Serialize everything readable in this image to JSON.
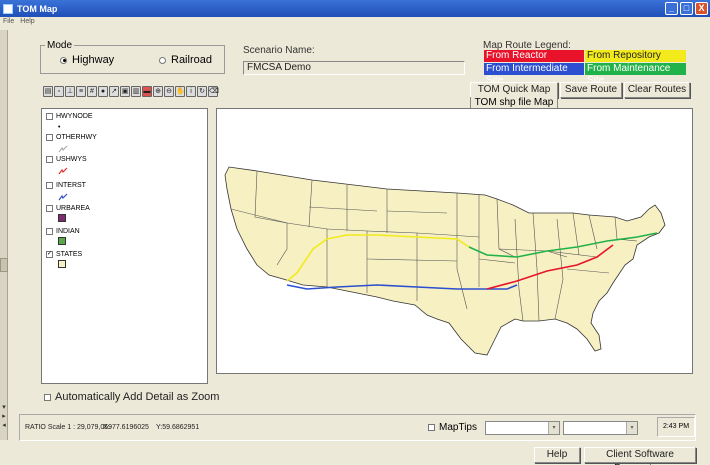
{
  "window": {
    "title": "TOM Map",
    "min_glyph": "_",
    "max_glyph": "□",
    "close_glyph": "X"
  },
  "menu": {
    "file": "File",
    "help": "Help"
  },
  "mode": {
    "legend": "Mode",
    "highway": "Highway",
    "railroad": "Railroad",
    "selected": "Highway"
  },
  "scenario": {
    "label": "Scenario Name:",
    "value": "FMCSA Demo"
  },
  "route_legend": {
    "title": "Map Route Legend:",
    "from_reactor": "From Reactor",
    "from_repository": "From Repository",
    "from_intermediate": "From Intermediate Site",
    "from_maintenance": "From Maintenance Site",
    "colors": {
      "reactor": "#e8132a",
      "repository": "#f2ea1a",
      "intermediate": "#2b4fd0",
      "maintenance": "#22b24a"
    }
  },
  "toolbar": {
    "icons": [
      "print-icon",
      "save-icon",
      "identify-icon",
      "layers-icon",
      "binoculars-icon",
      "globe-icon",
      "select-icon",
      "select-rect-icon",
      "select-poly-icon",
      "zoom-in-icon",
      "zoom-out-icon",
      "full-extent-icon",
      "pan-icon",
      "info-icon",
      "refresh-icon",
      "clear-icon"
    ]
  },
  "tabs": {
    "quick_map": "TOM Quick Map",
    "shp_map": "TOM shp file Map"
  },
  "buttons": {
    "save_route": "Save Route",
    "clear_routes": "Clear Routes",
    "help": "Help",
    "client_params": "Client Software Parameters"
  },
  "layers": [
    {
      "name": "HWYNODE",
      "checked": false
    },
    {
      "name": "OTHERHWY",
      "checked": false
    },
    {
      "name": "USHWYS",
      "checked": false
    },
    {
      "name": "INTERST",
      "checked": false
    },
    {
      "name": "URBAREA",
      "checked": false
    },
    {
      "name": "INDIAN",
      "checked": false
    },
    {
      "name": "STATES",
      "checked": true
    }
  ],
  "layer_symbols": {
    "urbarea": "#7d2a6e",
    "indian": "#5aa84a",
    "states": "#f6f0c2",
    "ushwys": "#e03030",
    "interst": "#3050c0",
    "otherhwy": "#a0a0a0"
  },
  "auto_detail": "Automatically Add Detail as Zoom",
  "status": {
    "scale": "RATIO Scale 1 : 29,079,059",
    "x": "X:-77.6196025",
    "y": "Y:59.6862951",
    "maptips": "MapTips",
    "time": "2:43 PM"
  },
  "map": {
    "land_color": "#f6f0c2",
    "border_color": "#333333"
  }
}
